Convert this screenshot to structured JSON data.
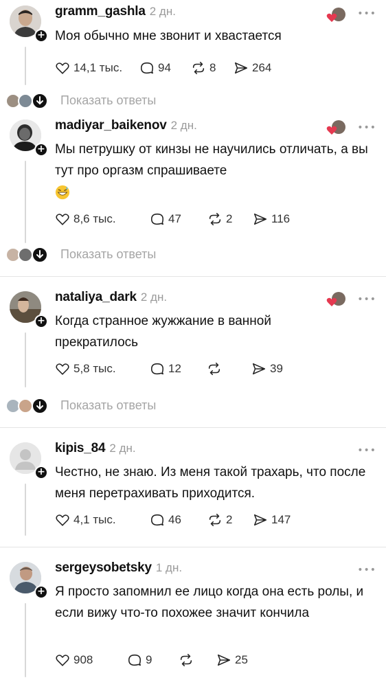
{
  "posts": [
    {
      "username": "gramm_gashla",
      "time": "2 дн.",
      "text": "Моя обычно мне звонит и хвастается",
      "likes": "14,1 тыс.",
      "comments": "94",
      "reposts": "8",
      "shares": "264",
      "show_replies": "Показать ответы"
    },
    {
      "username": "madiyar_baikenov",
      "time": "2 дн.",
      "text": "Мы петрушку от кинзы не научились отличать, а вы тут про оргазм спрашиваете",
      "likes": "8,6 тыс.",
      "comments": "47",
      "reposts": "2",
      "shares": "116",
      "show_replies": "Показать ответы"
    },
    {
      "username": "nataliya_dark",
      "time": "2 дн.",
      "text": "Когда странное жужжание в ванной прекратилось",
      "likes": "5,8 тыс.",
      "comments": "12",
      "reposts": "",
      "shares": "39",
      "show_replies": "Показать ответы"
    },
    {
      "username": "kipis_84",
      "time": "2 дн.",
      "text": "Честно, не знаю. Из меня такой трахарь, что после меня перетрахивать приходится.",
      "likes": "4,1 тыс.",
      "comments": "46",
      "reposts": "2",
      "shares": "147"
    },
    {
      "username": "sergeysobetsky",
      "time": "1 дн.",
      "text": "Я просто запомнил ее лицо когда она есть ролы, и если вижу что-то похожее значит кончила",
      "likes": "908",
      "comments": "9",
      "reposts": "",
      "shares": "25"
    }
  ],
  "more_glyph": "•••"
}
